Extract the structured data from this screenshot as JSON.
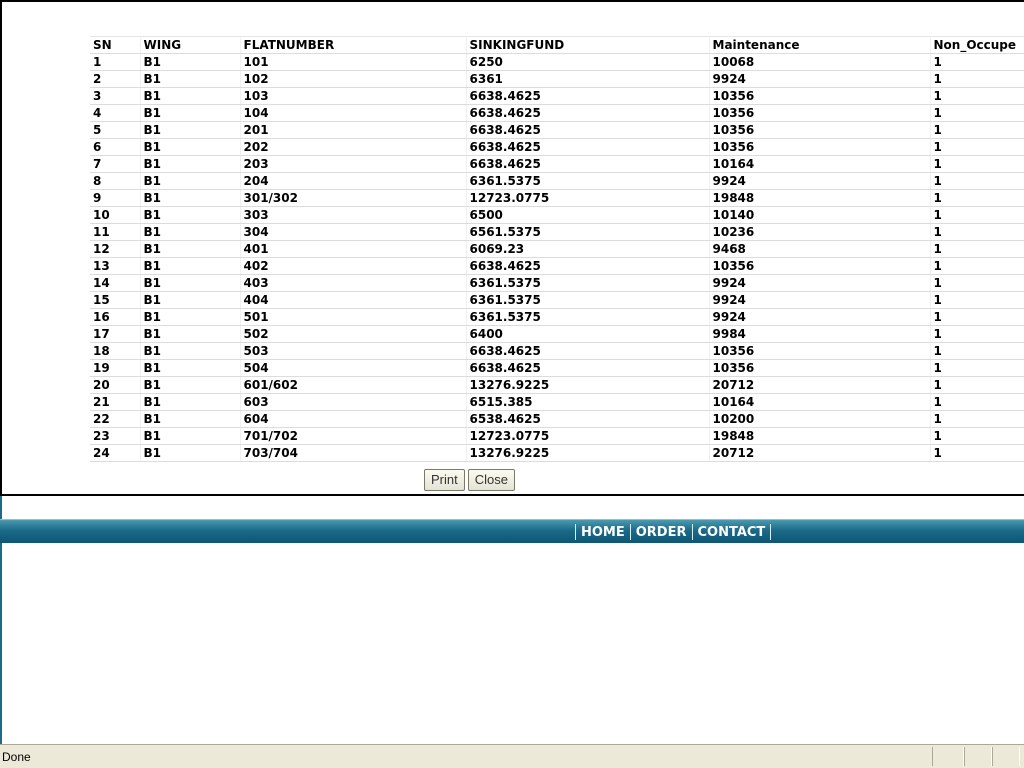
{
  "table": {
    "headers": [
      "SN",
      "WING",
      "FLATNUMBER",
      "SINKINGFUND",
      "Maintenance",
      "Non_Occupe"
    ],
    "rows": [
      [
        "1",
        "B1",
        "101",
        "6250",
        "10068",
        "1"
      ],
      [
        "2",
        "B1",
        "102",
        "6361",
        "9924",
        "1"
      ],
      [
        "3",
        "B1",
        "103",
        "6638.4625",
        "10356",
        "1"
      ],
      [
        "4",
        "B1",
        "104",
        "6638.4625",
        "10356",
        "1"
      ],
      [
        "5",
        "B1",
        "201",
        "6638.4625",
        "10356",
        "1"
      ],
      [
        "6",
        "B1",
        "202",
        "6638.4625",
        "10356",
        "1"
      ],
      [
        "7",
        "B1",
        "203",
        "6638.4625",
        "10164",
        "1"
      ],
      [
        "8",
        "B1",
        "204",
        "6361.5375",
        "9924",
        "1"
      ],
      [
        "9",
        "B1",
        "301/302",
        "12723.0775",
        "19848",
        "1"
      ],
      [
        "10",
        "B1",
        "303",
        "6500",
        "10140",
        "1"
      ],
      [
        "11",
        "B1",
        "304",
        "6561.5375",
        "10236",
        "1"
      ],
      [
        "12",
        "B1",
        "401",
        "6069.23",
        "9468",
        "1"
      ],
      [
        "13",
        "B1",
        "402",
        "6638.4625",
        "10356",
        "1"
      ],
      [
        "14",
        "B1",
        "403",
        "6361.5375",
        "9924",
        "1"
      ],
      [
        "15",
        "B1",
        "404",
        "6361.5375",
        "9924",
        "1"
      ],
      [
        "16",
        "B1",
        "501",
        "6361.5375",
        "9924",
        "1"
      ],
      [
        "17",
        "B1",
        "502",
        "6400",
        "9984",
        "1"
      ],
      [
        "18",
        "B1",
        "503",
        "6638.4625",
        "10356",
        "1"
      ],
      [
        "19",
        "B1",
        "504",
        "6638.4625",
        "10356",
        "1"
      ],
      [
        "20",
        "B1",
        "601/602",
        "13276.9225",
        "20712",
        "1"
      ],
      [
        "21",
        "B1",
        "603",
        "6515.385",
        "10164",
        "1"
      ],
      [
        "22",
        "B1",
        "604",
        "6538.4625",
        "10200",
        "1"
      ],
      [
        "23",
        "B1",
        "701/702",
        "12723.0775",
        "19848",
        "1"
      ],
      [
        "24",
        "B1",
        "703/704",
        "13276.9225",
        "20712",
        "1"
      ]
    ]
  },
  "buttons": {
    "print_label": "Print",
    "close_label": "Close"
  },
  "nav": {
    "items": [
      {
        "label": "HOME"
      },
      {
        "label": "ORDER"
      },
      {
        "label": "CONTACT"
      }
    ]
  },
  "status_bar": {
    "text": "Done"
  },
  "colors": {
    "nav_bar": "#1b6a88",
    "status_bar": "#ece9d8"
  }
}
